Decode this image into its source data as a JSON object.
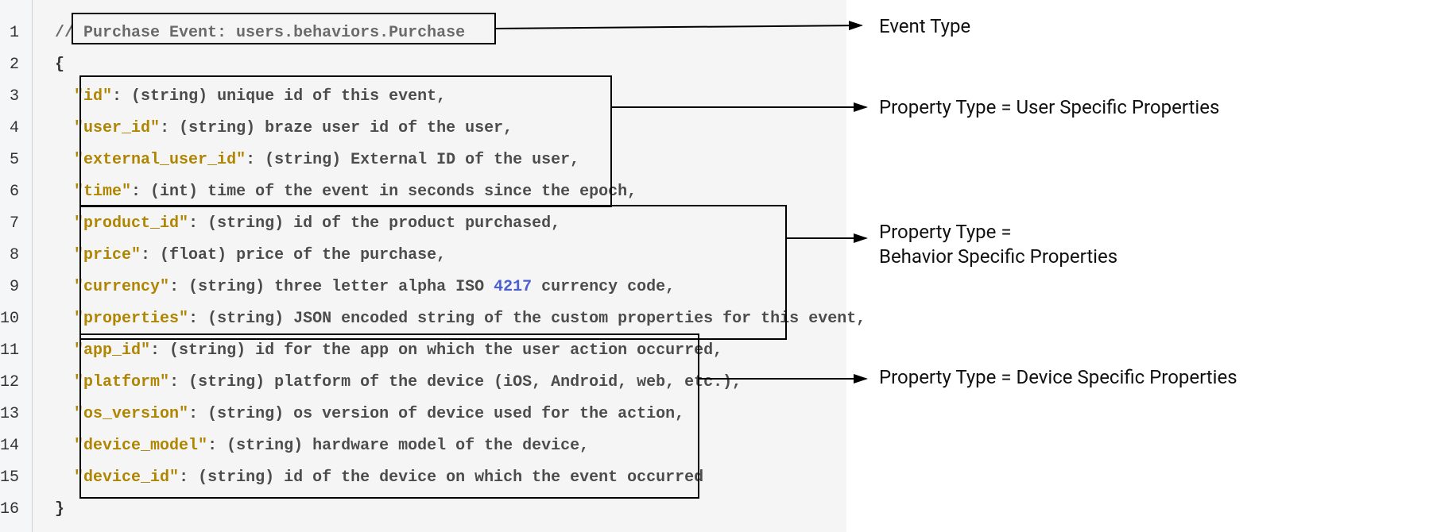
{
  "line_numbers": [
    "1",
    "2",
    "3",
    "4",
    "5",
    "6",
    "7",
    "8",
    "9",
    "10",
    "11",
    "12",
    "13",
    "14",
    "15",
    "16"
  ],
  "code": {
    "comment": "// Purchase Event: users.behaviors.Purchase",
    "open_brace": "{",
    "close_brace": "}",
    "lines": [
      {
        "key": "\"id\"",
        "rest": ": (string) unique id of this event,"
      },
      {
        "key": "\"user_id\"",
        "rest": ": (string) braze user id of the user,"
      },
      {
        "key": "\"external_user_id\"",
        "rest": ": (string) External ID of the user,"
      },
      {
        "key": "\"time\"",
        "rest": ": (int) time of the event in seconds since the epoch,"
      },
      {
        "key": "\"product_id\"",
        "rest": ": (string) id of the product purchased,"
      },
      {
        "key": "\"price\"",
        "rest": ": (float) price of the purchase,"
      },
      {
        "key": "\"currency\"",
        "rest_before_num": ": (string) three letter alpha ISO ",
        "num": "4217",
        "rest_after_num": " currency code,"
      },
      {
        "key": "\"properties\"",
        "rest": ": (string) JSON encoded string of the custom properties for this event,"
      },
      {
        "key": "\"app_id\"",
        "rest": ": (string) id for the app on which the user action occurred,"
      },
      {
        "key": "\"platform\"",
        "rest": ": (string) platform of the device (iOS, Android, web, etc.),"
      },
      {
        "key": "\"os_version\"",
        "rest": ": (string) os version of device used for the action,"
      },
      {
        "key": "\"device_model\"",
        "rest": ": (string) hardware model of the device,"
      },
      {
        "key": "\"device_id\"",
        "rest": ": (string) id of the device on which the event occurred"
      }
    ]
  },
  "annotations": {
    "event_type": "Event Type",
    "user_props": "Property Type = User Specific Properties",
    "behavior_props_l1": "Property Type =",
    "behavior_props_l2": "Behavior Specific Properties",
    "device_props": "Property Type = Device Specific Properties"
  }
}
